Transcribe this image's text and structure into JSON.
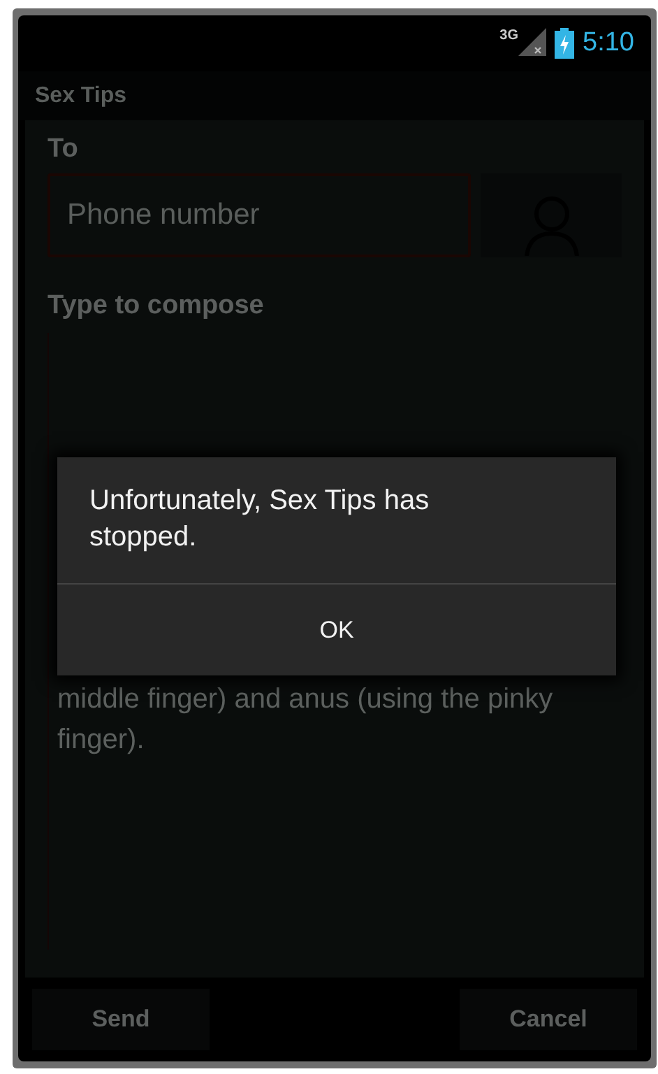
{
  "status_bar": {
    "network": "3G",
    "time": "5:10"
  },
  "title_bar": {
    "title": "Sex Tips"
  },
  "form": {
    "to_label": "To",
    "phone_placeholder": "Phone number",
    "compose_label": "Type to compose",
    "message_text": "middle finger) and anus (using the pinky finger)."
  },
  "buttons": [
    {
      "label": "Send"
    },
    {
      "label": "Cancel"
    }
  ],
  "dialog": {
    "message": "Unfortunately, Sex Tips has stopped.",
    "button": "OK"
  }
}
